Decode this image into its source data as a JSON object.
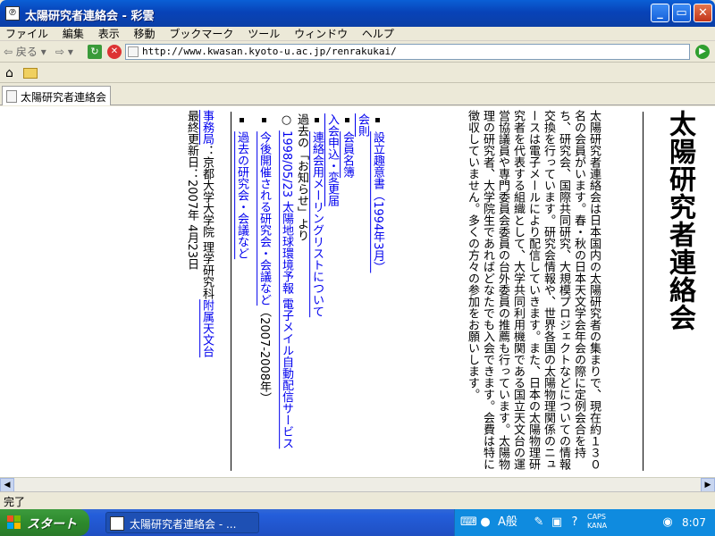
{
  "window": {
    "title": "太陽研究者連絡会 - 彩雲",
    "min_label": "_",
    "max_label": "▭",
    "close_label": "✕"
  },
  "menu": [
    "ファイル",
    "編集",
    "表示",
    "移動",
    "ブックマーク",
    "ツール",
    "ウィンドウ",
    "ヘルプ"
  ],
  "nav": {
    "back_label": "戻る",
    "url": "http://www.kwasan.kyoto-u.ac.jp/renrakukai/"
  },
  "tab": {
    "label": "太陽研究者連絡会"
  },
  "page": {
    "heading": "太陽研究者連絡会",
    "intro": "太陽研究者連絡会は日本国内の太陽研究者の集まりで、現在約１３０名の会員がいます。春・秋の日本天文学会年会の際に定例会合を持ち、研究会、国際共同研究、大規模プロジェクトなどについての情報交換を行っています。研究会情報や、世界各国の太陽物理関係のニュースは電子メールにより配信していきます。また、日本の太陽物理研究者を代表する組織として、大学共同利用機関である国立天文台の運営協議員や専門委員会委員の台外委員の推薦も行っています。太陽物理の研究者、大学院生であればどなたでも入会できます。会費は特に徴収していません。多くの方々の参加をお願いします。",
    "group1": {
      "links": [
        "設立趣意書（1994年3月）",
        "会則",
        "会員名簿",
        "入会申込・変更届",
        "連絡会用メーリングリストについて"
      ],
      "news_prefix": "過去の「お知らせ」",
      "news_suffix": "より"
    },
    "item_circle": {
      "text": "1998/05/23 太陽地球環境予報 電子メイル自動配信サービス"
    },
    "group2": {
      "link1": "今後開催される研究会・会議など",
      "link1_suffix": "（2007-2008年）",
      "link2": "過去の研究会・会議など"
    },
    "footer": {
      "office_link": "事務局",
      "office_text": "：京都大学大学院 理学研究科",
      "observatory_link": "附属天文台",
      "updated": "最終更新日：2007年 4月23日"
    }
  },
  "status": {
    "text": "完了"
  },
  "taskbar": {
    "start_label": "スタート",
    "task_label": "太陽研究者連絡会 - ...",
    "clock": "8:07",
    "ime_label": "A般",
    "caps": "CAPS",
    "kana": "KANA"
  }
}
